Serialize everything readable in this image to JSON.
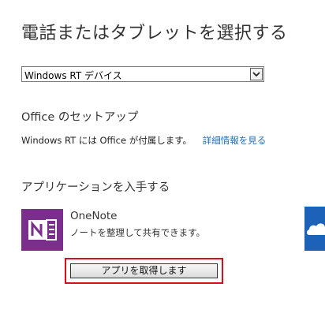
{
  "page": {
    "title": "電話またはタブレットを選択する"
  },
  "device_select": {
    "value": "Windows RT デバイス"
  },
  "office": {
    "heading": "Office のセットアップ",
    "note": "Windows RT には Office が付属します。",
    "link": "詳細情報を見る"
  },
  "apps": {
    "heading": "アプリケーションを入手する",
    "items": [
      {
        "name": "OneNote",
        "description": "ノートを整理して共有できます。",
        "icon": "onenote-icon",
        "tile_color": "#7b2f8c",
        "button_label": "アプリを取得します"
      }
    ],
    "next_tile": {
      "icon": "skydrive-cloud-icon",
      "tile_color": "#1c62b9"
    }
  },
  "colors": {
    "link": "#1e6bb8",
    "highlight_border": "#d1121b"
  }
}
